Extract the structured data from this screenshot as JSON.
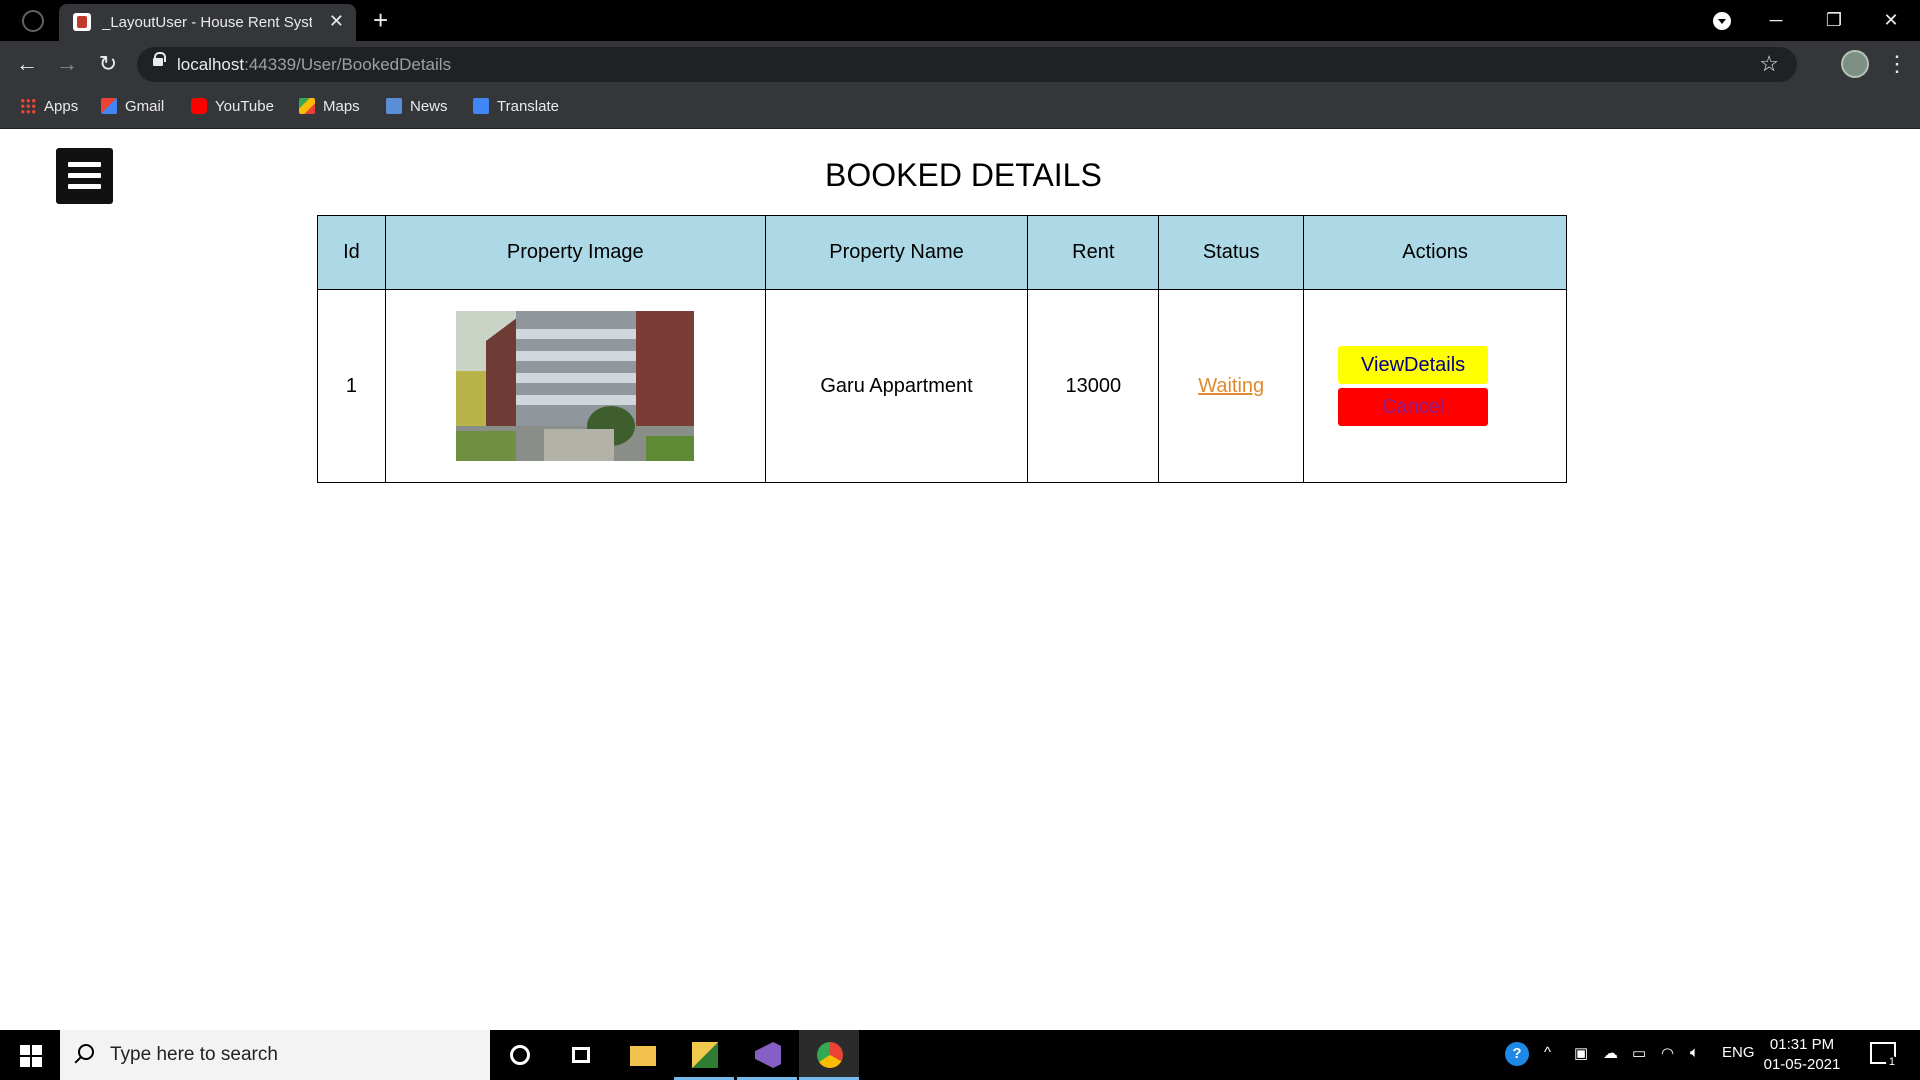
{
  "browser": {
    "tab_title": "_LayoutUser - House Rent System",
    "url_host": "localhost",
    "url_path": ":44339/User/BookedDetails",
    "bookmarks": [
      {
        "label": "Apps",
        "icon": "apps-grid-icon"
      },
      {
        "label": "Gmail",
        "icon": "gmail-icon"
      },
      {
        "label": "YouTube",
        "icon": "youtube-icon"
      },
      {
        "label": "Maps",
        "icon": "maps-icon"
      },
      {
        "label": "News",
        "icon": "news-icon"
      },
      {
        "label": "Translate",
        "icon": "translate-icon"
      }
    ]
  },
  "page": {
    "title": "BOOKED DETAILS",
    "table": {
      "headers": [
        "Id",
        "Property Image",
        "Property Name",
        "Rent",
        "Status",
        "Actions"
      ],
      "rows": [
        {
          "id": "1",
          "image_alt": "apartment building photo",
          "name": "Garu Appartment",
          "rent": "13000",
          "status": "Waiting",
          "view_label": "ViewDetails",
          "cancel_label": "Cancel"
        }
      ]
    }
  },
  "taskbar": {
    "search_placeholder": "Type here to search",
    "language": "ENG",
    "time": "01:31 PM",
    "date": "01-05-2021",
    "notification_count": "1"
  },
  "colors": {
    "header_bg": "#add8e6",
    "view_button": "#ffff00",
    "cancel_button": "#ff0000",
    "status_link": "#e08a2e"
  }
}
